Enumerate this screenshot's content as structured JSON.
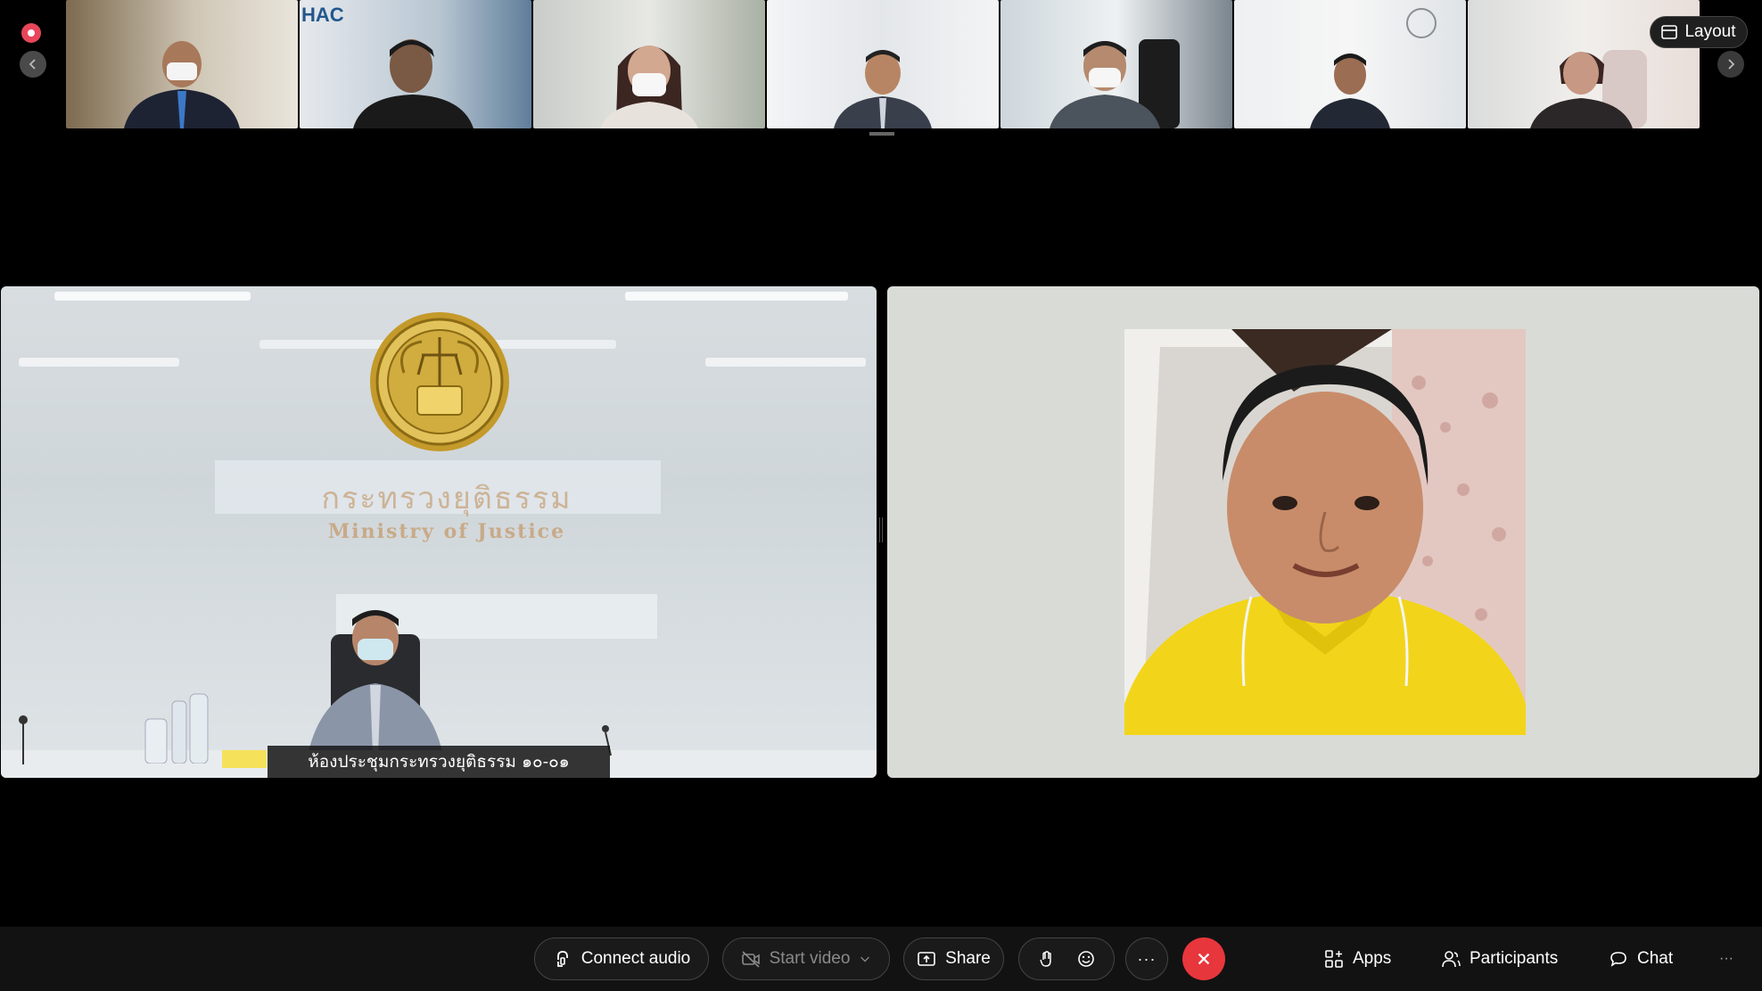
{
  "recording": {
    "indicator": "recording-indicator"
  },
  "top_strip": {
    "layout_label": "Layout",
    "thumbnail_count": 7,
    "thumbnail_logo_text": "HAC"
  },
  "main": {
    "left_tile": {
      "thai_sign": "กระทรวงยุติธรรม",
      "english_sign": "Ministry of Justice",
      "name_label": "ห้องประชุมกระทรวงยุติธรรม ๑๐-๐๑"
    }
  },
  "toolbar": {
    "connect_audio": "Connect audio",
    "start_video": "Start video",
    "share": "Share",
    "apps": "Apps",
    "participants": "Participants",
    "chat": "Chat",
    "more": "···"
  },
  "colors": {
    "end_call": "#e8363d",
    "recording": "#e8465a",
    "shirt": "#f2d51a"
  }
}
